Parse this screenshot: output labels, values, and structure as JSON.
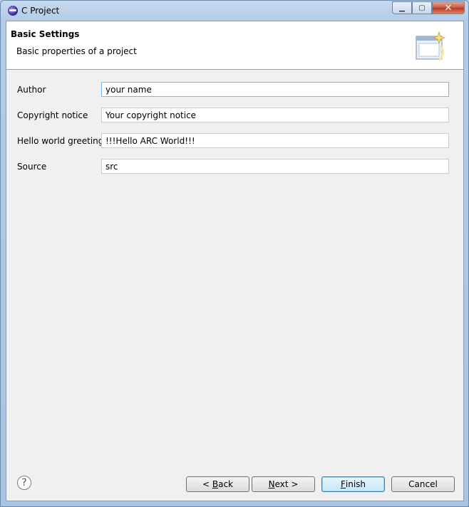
{
  "window": {
    "title": "C Project",
    "icon": "eclipse-icon",
    "caption_buttons": [
      "minimize-icon",
      "maximize-icon",
      "close-icon"
    ]
  },
  "header": {
    "title": "Basic Settings",
    "description": "Basic properties of a project",
    "banner_icon": "wizard-banner-icon"
  },
  "form": {
    "fields": [
      {
        "label": "Author",
        "value": "your name"
      },
      {
        "label": "Copyright notice",
        "value": "Your copyright notice"
      },
      {
        "label": "Hello world greeting",
        "value": "!!!Hello ARC World!!!"
      },
      {
        "label": "Source",
        "value": "src"
      }
    ]
  },
  "footer": {
    "help_icon": "help-icon",
    "back": {
      "prefix": "< ",
      "mnemonic": "B",
      "rest": "ack"
    },
    "next": {
      "mnemonic": "N",
      "rest": "ext >"
    },
    "finish": {
      "mnemonic": "F",
      "rest": "inish"
    },
    "cancel": "Cancel"
  },
  "colors": {
    "title_bar": "#b3cbe6",
    "content_bg": "#f0f0f0",
    "focus_border": "#7eb4ea",
    "default_button": "#c6e6f8"
  }
}
